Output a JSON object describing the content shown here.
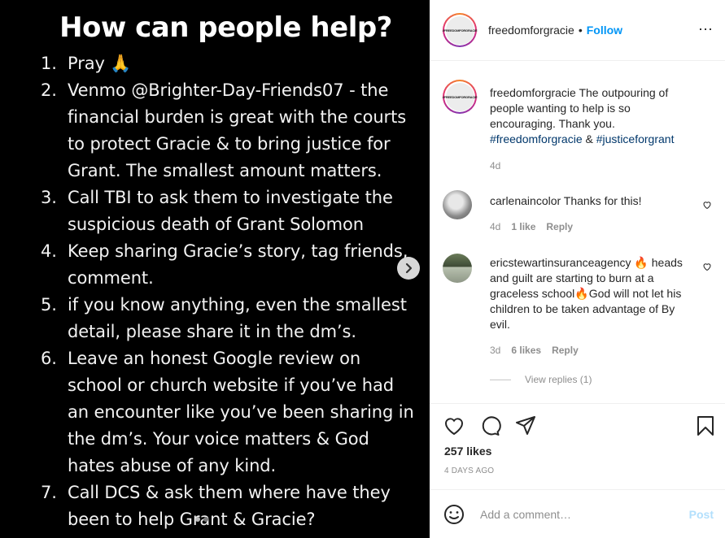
{
  "image": {
    "title": "How can people help?",
    "items": [
      {
        "num": "1.",
        "text": "Pray 🙏"
      },
      {
        "num": "2.",
        "text": "Venmo @Brighter-Day-Friends07  - the financial burden is great with the courts to protect Gracie & to bring justice for Grant.  The smallest amount matters."
      },
      {
        "num": "3.",
        "text": "Call TBI to ask them to investigate the suspicious death of Grant Solomon"
      },
      {
        "num": "4.",
        "text": "Keep sharing Gracie’s story, tag friends, comment."
      },
      {
        "num": "5.",
        "text": "if you know anything, even the smallest detail, please share it in the dm’s."
      },
      {
        "num": "6.",
        "text": "Leave an honest Google review on school or church website if you’ve had an encounter like you’ve been sharing in the dm’s. Your voice matters & God hates abuse of any kind."
      },
      {
        "num": "7.",
        "text": "Call DCS & ask them where have they been to help Grant & Gracie?"
      }
    ]
  },
  "header": {
    "avatar_text": "#FREEDOMFORGRACIE",
    "username": "freedomforgracie",
    "separator": "•",
    "follow_label": "Follow",
    "more_icon": "⋯"
  },
  "caption": {
    "username": "freedomforgracie",
    "text": " The outpouring of people wanting to help is so encouraging. Thank you. ",
    "tag1": "#freedomforgracie",
    "amp": " & ",
    "tag2": "#justiceforgrant",
    "time": "4d"
  },
  "comments": [
    {
      "username": "carlenaincolor",
      "text": " Thanks for this!",
      "time": "4d",
      "likes": "1 like",
      "reply": "Reply"
    },
    {
      "username": "ericstewartinsuranceagency",
      "text": " 🔥 heads and guilt are starting to burn at a graceless school🔥God will not let his children to be taken advantage of By evil.",
      "time": "3d",
      "likes": "6 likes",
      "reply": "Reply",
      "view_replies": "View replies (1)"
    }
  ],
  "actions": {
    "likes": "257 likes",
    "date": "4 DAYS AGO"
  },
  "add_comment": {
    "placeholder": "Add a comment…",
    "post_label": "Post"
  }
}
